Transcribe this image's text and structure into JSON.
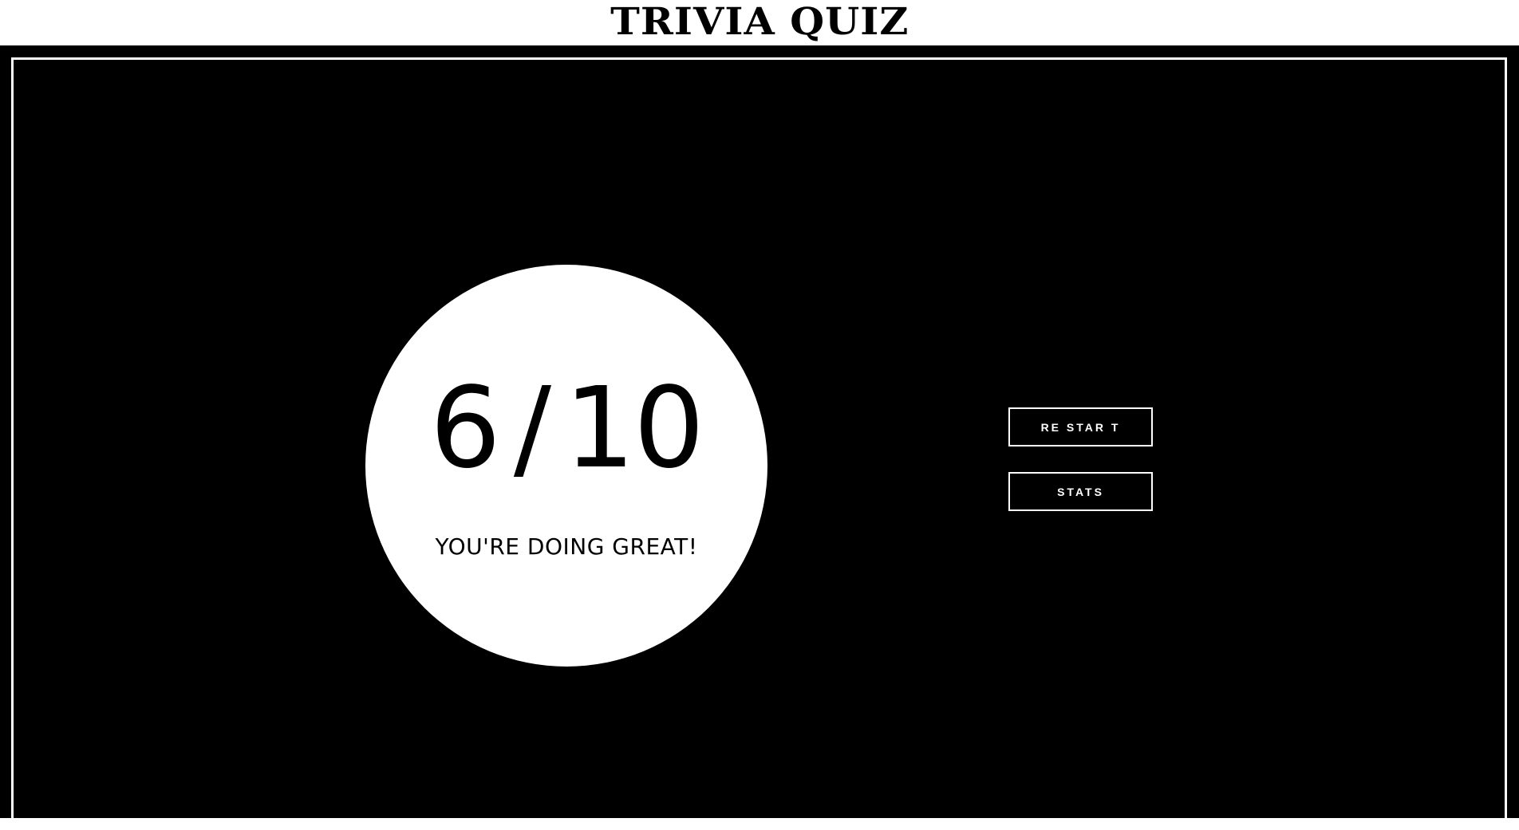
{
  "header": {
    "title": "TRIVIA QUIZ"
  },
  "result": {
    "score": "6",
    "separator": "/",
    "total": "10",
    "message": "YOU'RE DOING GREAT!"
  },
  "actions": {
    "restart_label": "RE STAR T",
    "stats_label": "STATS"
  },
  "colors": {
    "background": "#000000",
    "foreground": "#ffffff",
    "text_on_circle": "#000000"
  }
}
